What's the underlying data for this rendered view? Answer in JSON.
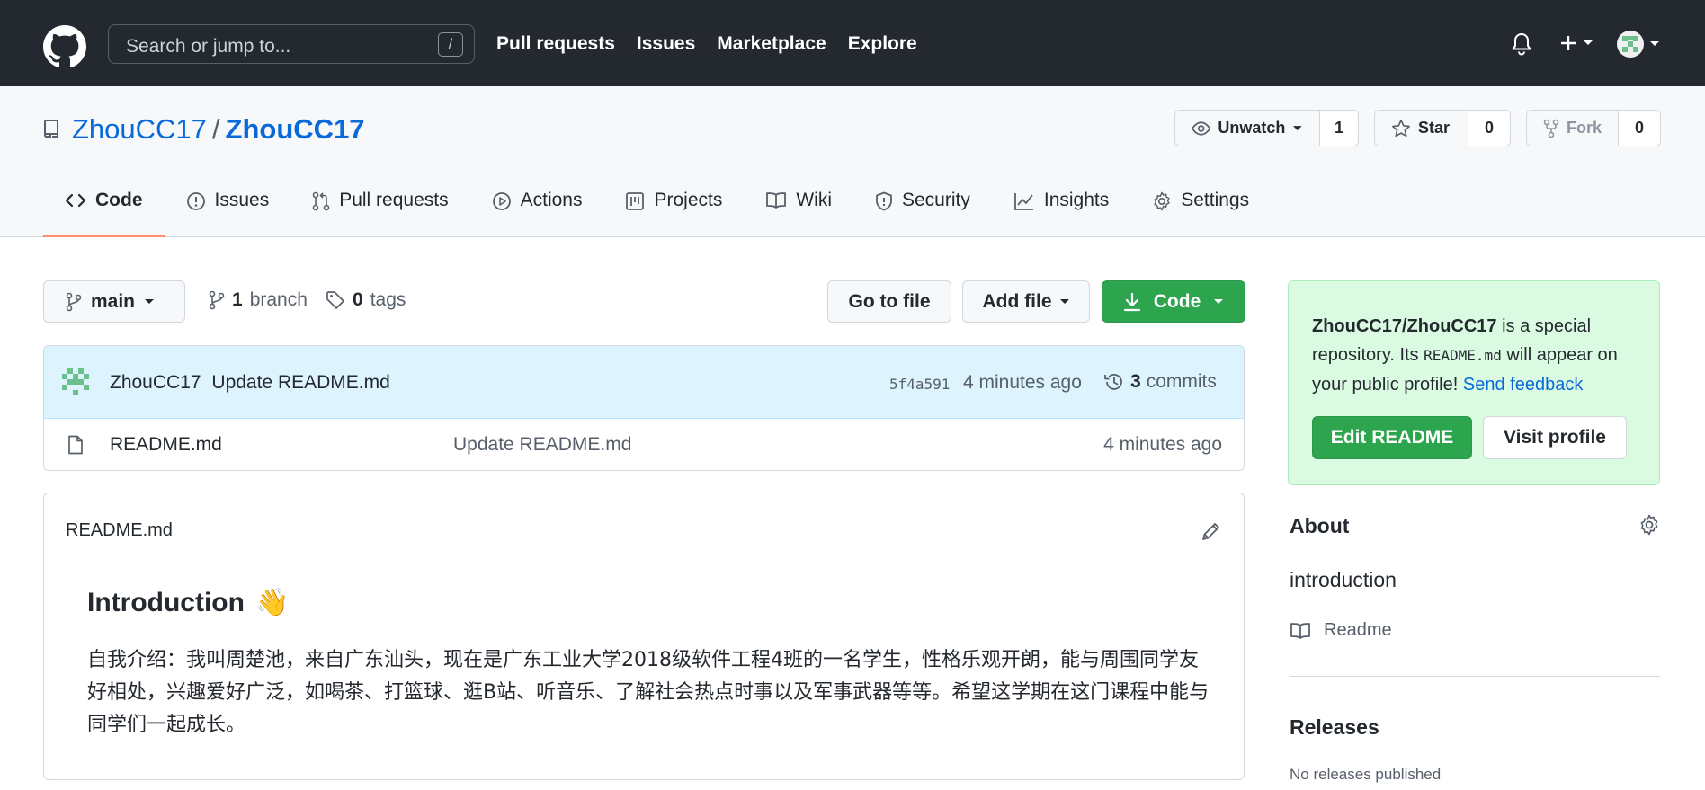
{
  "header": {
    "search_placeholder": "Search or jump to...",
    "search_key": "/",
    "nav": [
      "Pull requests",
      "Issues",
      "Marketplace",
      "Explore"
    ]
  },
  "repo": {
    "owner": "ZhouCC17",
    "separator": "/",
    "name": "ZhouCC17",
    "watch_label": "Unwatch",
    "watch_count": "1",
    "star_label": "Star",
    "star_count": "0",
    "fork_label": "Fork",
    "fork_count": "0"
  },
  "tabs": [
    {
      "label": "Code",
      "icon": "code-icon"
    },
    {
      "label": "Issues",
      "icon": "issue-icon"
    },
    {
      "label": "Pull requests",
      "icon": "pull-request-icon"
    },
    {
      "label": "Actions",
      "icon": "play-icon"
    },
    {
      "label": "Projects",
      "icon": "project-icon"
    },
    {
      "label": "Wiki",
      "icon": "book-icon"
    },
    {
      "label": "Security",
      "icon": "shield-icon"
    },
    {
      "label": "Insights",
      "icon": "graph-icon"
    },
    {
      "label": "Settings",
      "icon": "gear-icon"
    }
  ],
  "toolbar": {
    "branch": "main",
    "branch_count": "1",
    "branch_label": "branch",
    "tag_count": "0",
    "tag_label": "tags",
    "go_to_file": "Go to file",
    "add_file": "Add file",
    "code": "Code"
  },
  "commit": {
    "author": "ZhouCC17",
    "message": "Update README.md",
    "hash": "5f4a591",
    "time": "4 minutes ago",
    "count": "3",
    "count_label": "commits"
  },
  "files": [
    {
      "name": "README.md",
      "message": "Update README.md",
      "time": "4 minutes ago"
    }
  ],
  "readme": {
    "filename": "README.md",
    "heading": "Introduction",
    "heading_emoji": "👋",
    "body": "自我介绍：我叫周楚池，来自广东汕头，现在是广东工业大学2018级软件工程4班的一名学生，性格乐观开朗，能与周围同学友好相处，兴趣爱好广泛，如喝茶、打篮球、逛B站、听音乐、了解社会热点时事以及军事武器等等。希望这学期在这门课程中能与同学们一起成长。"
  },
  "special": {
    "repo_path": "ZhouCC17/ZhouCC17",
    "text_1": " is a special repository. Its ",
    "code": "README.md",
    "text_2": " will appear on your public profile! ",
    "feedback": "Send feedback",
    "edit_readme": "Edit README",
    "visit_profile": "Visit profile"
  },
  "about": {
    "title": "About",
    "description": "introduction",
    "readme_link": "Readme"
  },
  "releases": {
    "title": "Releases",
    "empty": "No releases published"
  },
  "colors": {
    "header_bg": "#24292f",
    "link": "#0969da",
    "green": "#2da44e",
    "tab_underline": "#fd8c73"
  }
}
